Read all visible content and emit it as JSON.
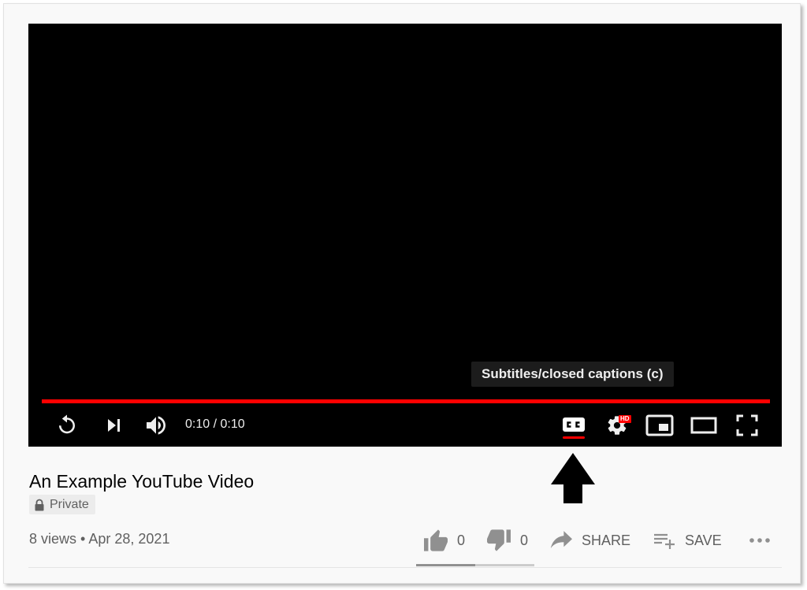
{
  "player": {
    "progress_fraction": 1.0,
    "time_display": "0:10 / 0:10",
    "tooltip": "Subtitles/closed captions (c)",
    "hd_badge": "HD",
    "cc_label": "CC",
    "controls": [
      "replay-icon",
      "next-icon",
      "volume-icon",
      "captions-icon",
      "settings-icon",
      "miniplayer-icon",
      "theater-icon",
      "fullscreen-icon"
    ],
    "colors": {
      "progress": "#ff0000",
      "cc_active": "#ff0000",
      "hd_badge": "#ff0000"
    }
  },
  "video": {
    "title": "An Example YouTube Video",
    "privacy": "Private",
    "views": "8 views",
    "separator": "•",
    "date": "Apr 28, 2021"
  },
  "actions": {
    "like_count": "0",
    "dislike_count": "0",
    "share_label": "SHARE",
    "save_label": "SAVE",
    "more_icon": "more-horizontal-icon",
    "like_ratio": 0.5
  },
  "annotation": {
    "icon": "arrow-up-icon"
  }
}
